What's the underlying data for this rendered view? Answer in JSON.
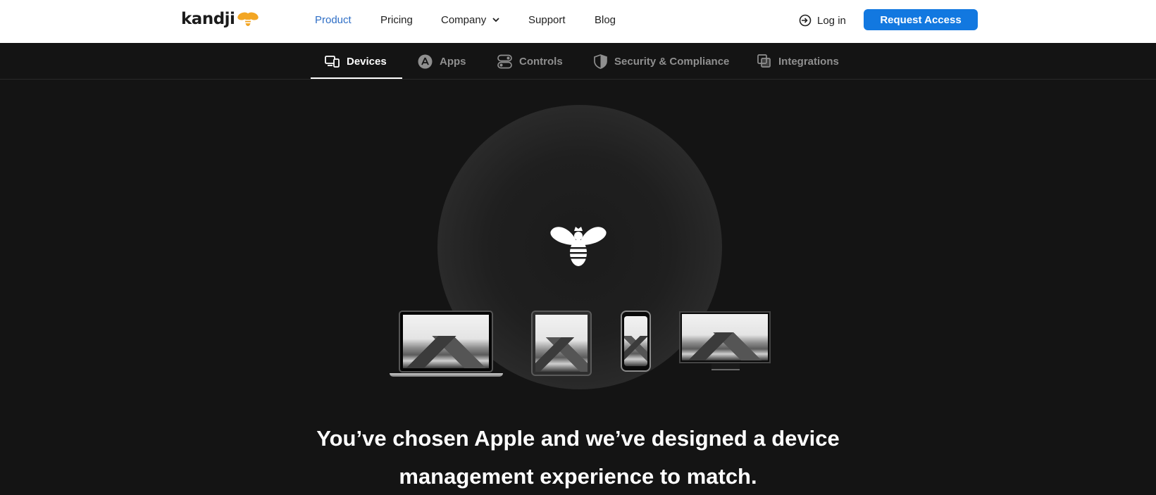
{
  "brand": {
    "name": "kandji",
    "accent": "#f3a623"
  },
  "topnav": {
    "items": [
      {
        "label": "Product",
        "active": true
      },
      {
        "label": "Pricing"
      },
      {
        "label": "Company",
        "has_dropdown": true
      },
      {
        "label": "Support"
      },
      {
        "label": "Blog"
      }
    ],
    "login_label": "Log in",
    "cta_label": "Request Access"
  },
  "subnav": {
    "tabs": [
      {
        "label": "Devices",
        "icon": "devices-icon",
        "active": true
      },
      {
        "label": "Apps",
        "icon": "app-store-icon"
      },
      {
        "label": "Controls",
        "icon": "toggle-icon"
      },
      {
        "label": "Security & Compliance",
        "icon": "shield-icon"
      },
      {
        "label": "Integrations",
        "icon": "integrations-icon"
      }
    ]
  },
  "hero": {
    "headline_line1": "You’ve chosen Apple and we’ve designed a device",
    "headline_line2": "management experience to match.",
    "devices": [
      "laptop",
      "tablet",
      "phone",
      "monitor"
    ]
  },
  "colors": {
    "primary_blue": "#1278e0",
    "active_link": "#2f6fc6",
    "dark_bg": "#141414"
  }
}
